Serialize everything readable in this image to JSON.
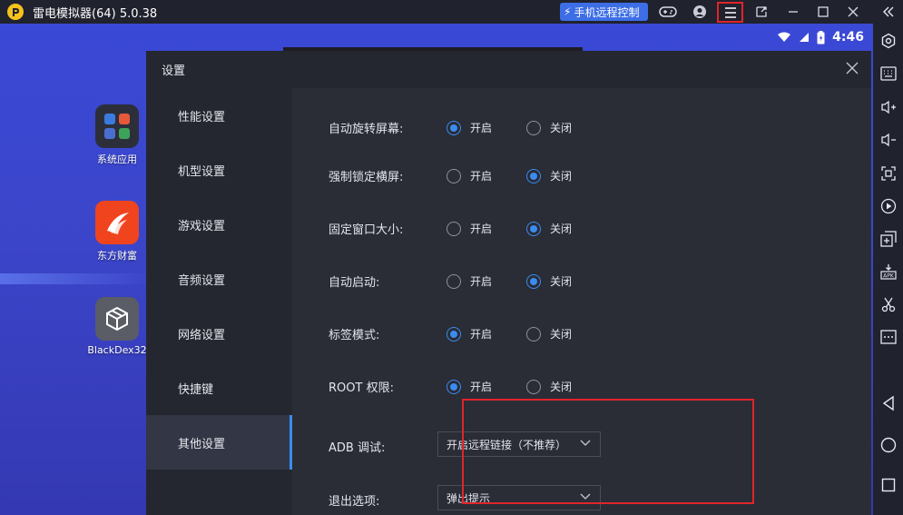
{
  "window": {
    "title": "雷电模拟器(64) 5.0.38",
    "remote_button": "手机远程控制"
  },
  "statusbar": {
    "time": "4:46"
  },
  "desktop": {
    "apps": [
      {
        "label": "系统应用"
      },
      {
        "label": "东方财富"
      },
      {
        "label": "BlackDex32"
      }
    ]
  },
  "dialog": {
    "title": "设置",
    "nav": [
      {
        "label": "性能设置"
      },
      {
        "label": "机型设置"
      },
      {
        "label": "游戏设置"
      },
      {
        "label": "音频设置"
      },
      {
        "label": "网络设置"
      },
      {
        "label": "快捷键"
      },
      {
        "label": "其他设置",
        "active": true
      }
    ],
    "options": [
      {
        "label": "自动旋转屏幕:",
        "on": "开启",
        "off": "关闭",
        "selected": "on"
      },
      {
        "label": "强制锁定横屏:",
        "on": "开启",
        "off": "关闭",
        "selected": "off"
      },
      {
        "label": "固定窗口大小:",
        "on": "开启",
        "off": "关闭",
        "selected": "off"
      },
      {
        "label": "自动启动:",
        "on": "开启",
        "off": "关闭",
        "selected": "off"
      },
      {
        "label": "标签模式:",
        "on": "开启",
        "off": "关闭",
        "selected": "on"
      },
      {
        "label": "ROOT 权限:",
        "on": "开启",
        "off": "关闭",
        "selected": "on"
      }
    ],
    "adb": {
      "label": "ADB 调试:",
      "value": "开启远程链接（不推荐）"
    },
    "exit": {
      "label": "退出选项:",
      "value": "弹出提示"
    }
  },
  "colors": {
    "accent": "#3a8cf0",
    "highlight": "#e0242a",
    "remote_button": "#3d6ee6"
  }
}
